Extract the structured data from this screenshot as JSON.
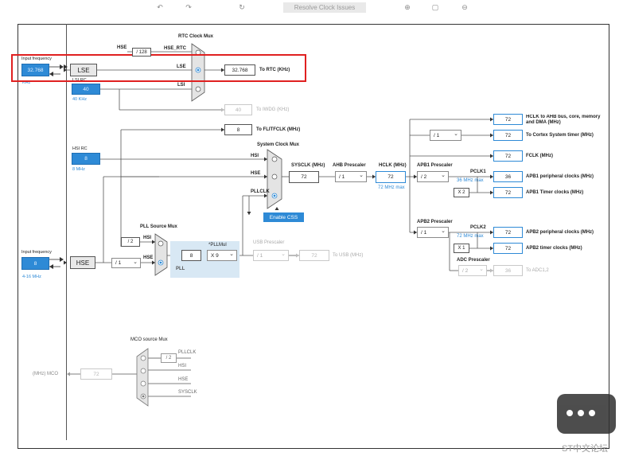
{
  "toolbar": {
    "resolve_label": "Resolve Clock Issues"
  },
  "left": {
    "input_frequency_top": "Input frequency",
    "input_value_top": "32.768",
    "khz_unit": "KHz",
    "lse": "LSE",
    "lsi_rc": "LSI RC",
    "lsi_value": "40",
    "lsi_unit": "40 KHz",
    "hsi_rc": "HSI RC",
    "hsi_value": "8",
    "hsi_unit": "8 MHz",
    "input_frequency_bottom": "Input frequency",
    "input_value_bottom": "8",
    "range_bottom": "4-16 MHz",
    "hse": "HSE"
  },
  "rtc": {
    "mux_title": "RTC Clock Mux",
    "hse_label": "HSE",
    "div128": "/ 128",
    "hse_rtc": "HSE_RTC",
    "lse_label": "LSE",
    "lsi_label": "LSI",
    "output_value": "32.768",
    "output_label": "To RTC (KHz)",
    "iwdg_value": "40",
    "iwdg_label": "To IWDG (KHz)",
    "flit_value": "8",
    "flit_label": "To FLITFCLK (MHz)"
  },
  "sysclk": {
    "mux_title": "System Clock Mux",
    "hsi": "HSI",
    "hse": "HSE",
    "pllclk": "PLLCLK",
    "enable_css": "Enable CSS",
    "sysclk_label": "SYSCLK (MHz)",
    "sysclk_value": "72",
    "ahb_label": "AHB Prescaler",
    "ahb_value": "/ 1",
    "hclk_label": "HCLK (MHz)",
    "hclk_value": "72",
    "hclk_max": "72 MHz max"
  },
  "apb1": {
    "label": "APB1 Prescaler",
    "value": "/ 2",
    "pclk1": "PCLK1",
    "pclk1_max": "36 MHz max",
    "x2": "X 2"
  },
  "apb2": {
    "label": "APB2 Prescaler",
    "value": "/ 1",
    "pclk2": "PCLK2",
    "pclk2_max": "72 MHz max",
    "x1": "X 1",
    "adc_label": "ADC Prescaler",
    "adc_value": "/ 2"
  },
  "outputs": {
    "hclk_ahb_value": "72",
    "hclk_ahb_label": "HCLK to AHB bus, core, memory and DMA (MHz)",
    "cortex_div": "/ 1",
    "cortex_value": "72",
    "cortex_label": "To Cortex System timer (MHz)",
    "fclk_value": "72",
    "fclk_label": "FCLK (MHz)",
    "apb1_periph_value": "36",
    "apb1_periph_label": "APB1 peripheral clocks (MHz)",
    "apb1_timer_value": "72",
    "apb1_timer_label": "APB1 Timer clocks (MHz)",
    "apb2_periph_value": "72",
    "apb2_periph_label": "APB2 peripheral clocks (MHz)",
    "apb2_timer_value": "72",
    "apb2_timer_label": "APB2 timer clocks (MHz)",
    "adc_value": "36",
    "adc_label": "To ADC1,2"
  },
  "pll": {
    "source_mux_title": "PLL Source Mux",
    "div2": "/ 2",
    "hsi": "HSI",
    "hse": "HSE",
    "hse_div": "/ 1",
    "pllmul_label": "*PLLMul",
    "pll_input": "8",
    "pllmul_value": "X 9",
    "pll_label": "PLL",
    "usb_label": "USB Prescaler",
    "usb_value": "/ 1",
    "usb_out": "72",
    "usb_out_label": "To USB (MHz)"
  },
  "mco": {
    "title": "MCO source Mux",
    "div2": "/ 2",
    "pllclk": "PLLCLK",
    "hsi": "HSI",
    "hse": "HSE",
    "sysclk": "SYSCLK",
    "value": "72",
    "label": "(MHz) MCO"
  },
  "watermark": {
    "text": "ST中文论坛"
  },
  "colors": {
    "accent": "#2e8ad6",
    "highlight": "#e02020",
    "pll_bg": "#d8e8f4"
  }
}
